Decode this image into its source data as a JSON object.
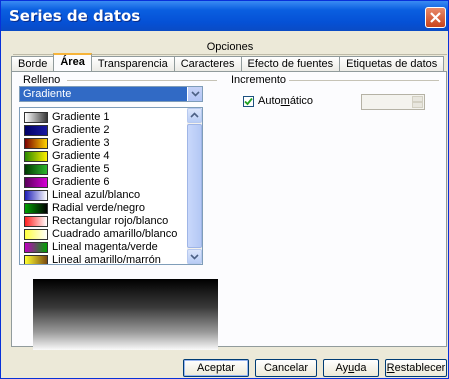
{
  "window": {
    "title": "Series de datos"
  },
  "group_tab": "Opciones",
  "tabs": [
    "Borde",
    "Área",
    "Transparencia",
    "Caracteres",
    "Efecto de fuentes",
    "Etiquetas de datos"
  ],
  "active_tab": "Área",
  "relleno": {
    "label": "Relleno",
    "selected": "Gradiente",
    "options": [
      {
        "label": "Gradiente 1",
        "colors": [
          "#ffffff",
          "#3a3a3a"
        ]
      },
      {
        "label": "Gradiente 2",
        "colors": [
          "#000066",
          "#1a1aa0"
        ]
      },
      {
        "label": "Gradiente 3",
        "colors": [
          "#7a0000",
          "#ffd400"
        ]
      },
      {
        "label": "Gradiente 4",
        "colors": [
          "#2a8a00",
          "#ffef00"
        ]
      },
      {
        "label": "Gradiente 5",
        "colors": [
          "#003a00",
          "#2db52d"
        ]
      },
      {
        "label": "Gradiente 6",
        "colors": [
          "#5a005a",
          "#d600d6"
        ]
      },
      {
        "label": "Lineal azul/blanco",
        "colors": [
          "#1f1fb8",
          "#ffffff"
        ]
      },
      {
        "label": "Radial verde/negro",
        "colors": [
          "#00a000",
          "#000000"
        ]
      },
      {
        "label": "Rectangular rojo/blanco",
        "colors": [
          "#ff2020",
          "#ffffff"
        ]
      },
      {
        "label": "Cuadrado amarillo/blanco",
        "colors": [
          "#ffff40",
          "#ffffff"
        ]
      },
      {
        "label": "Lineal magenta/verde",
        "colors": [
          "#c000c0",
          "#00a000"
        ]
      },
      {
        "label": "Lineal amarillo/marrón",
        "colors": [
          "#ffff30",
          "#7a4a10"
        ]
      }
    ]
  },
  "incremento": {
    "label": "Incremento",
    "automatico_label_pre": "Auto",
    "automatico_label_u": "m",
    "automatico_label_post": "ático",
    "automatico_checked": true
  },
  "buttons": {
    "accept": "Aceptar",
    "cancel": "Cancelar",
    "help_pre": "Ay",
    "help_u": "u",
    "help_post": "da",
    "reset_u": "R",
    "reset_post": "establecer"
  }
}
